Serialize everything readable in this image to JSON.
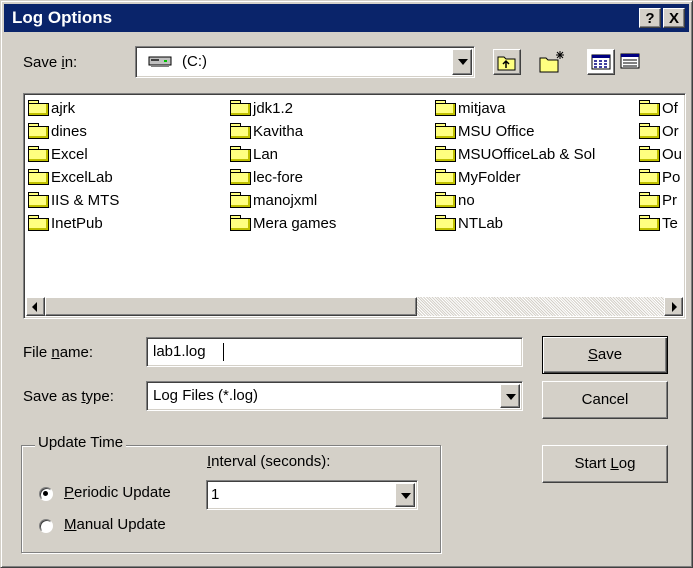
{
  "window": {
    "title": "Log Options"
  },
  "titlebar": {
    "help_label": "?",
    "close_label": "X"
  },
  "save_in": {
    "label_pre": "Save ",
    "label_key": "i",
    "label_post": "n:",
    "value": "(C:)"
  },
  "toolbar": {
    "icons": [
      "up-one-level-icon",
      "create-new-folder-icon",
      "list-view-icon",
      "details-view-icon"
    ]
  },
  "files": {
    "col1": [
      "ajrk",
      "dines",
      "Excel",
      "ExcelLab",
      "IIS & MTS",
      "InetPub"
    ],
    "col2": [
      "jdk1.2",
      "Kavitha",
      "Lan",
      "lec-fore",
      "manojxml",
      "Mera games"
    ],
    "col3": [
      "mitjava",
      "MSU Office",
      "MSUOfficeLab & Sol",
      "MyFolder",
      "no",
      "NTLab"
    ],
    "col4": [
      "Of",
      "Or",
      "Ou",
      "Po",
      "Pr",
      "Te"
    ]
  },
  "file_name": {
    "label_pre": "File ",
    "label_key": "n",
    "label_post": "ame:",
    "value": "lab1.log"
  },
  "save_as_type": {
    "label_pre": "Save as ",
    "label_key": "t",
    "label_post": "ype:",
    "value": "Log Files (*.log)"
  },
  "buttons": {
    "save_key": "S",
    "save_rest": "ave",
    "cancel": "Cancel",
    "start_log_pre": "Start ",
    "start_log_key": "L",
    "start_log_post": "og"
  },
  "update_time": {
    "legend": "Update Time",
    "interval_key": "I",
    "interval_rest": "nterval (seconds):",
    "interval_value": "1",
    "periodic_key": "P",
    "periodic_rest": "eriodic Update",
    "manual_key": "M",
    "manual_rest": "anual Update",
    "selected": "periodic"
  },
  "colors": {
    "titlebar": "#0a246a",
    "face": "#d4d0c8",
    "folder": "#ffff80"
  }
}
